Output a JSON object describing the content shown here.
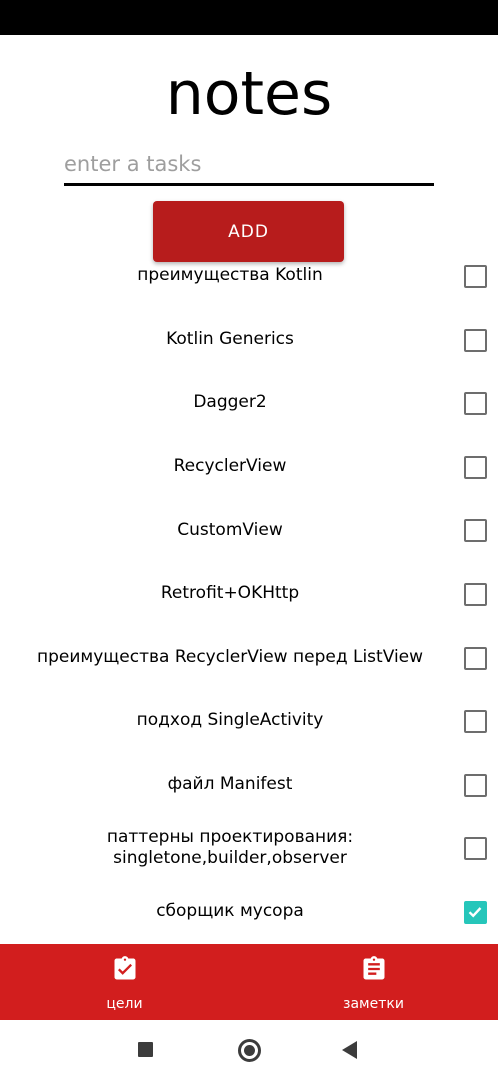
{
  "app": {
    "title": "notes"
  },
  "task_input": {
    "value": "",
    "placeholder": "enter a tasks"
  },
  "add_button": {
    "label": "ADD"
  },
  "tasks": [
    {
      "label": "преимущества Kotlin",
      "checked": false
    },
    {
      "label": "Kotlin Generics",
      "checked": false
    },
    {
      "label": "Dagger2",
      "checked": false
    },
    {
      "label": "RecyclerView",
      "checked": false
    },
    {
      "label": "CustomView",
      "checked": false
    },
    {
      "label": "Retrofit+OKHttp",
      "checked": false
    },
    {
      "label": "преимущества RecyclerView перед ListView",
      "checked": false
    },
    {
      "label": "подход SingleActivity",
      "checked": false
    },
    {
      "label": "файл Manifest",
      "checked": false
    },
    {
      "label": "паттерны проектирования: singletone,builder,observer",
      "checked": false
    },
    {
      "label": "сборщик мусора",
      "checked": true
    }
  ],
  "bottom_nav": {
    "items": [
      {
        "label": "цели",
        "icon": "clipboard-check-icon"
      },
      {
        "label": "заметки",
        "icon": "clipboard-text-icon"
      }
    ]
  },
  "system_nav": {
    "buttons": [
      "recents-icon",
      "home-icon",
      "back-icon"
    ]
  },
  "colors": {
    "accent": "#b71c1c",
    "nav_bar": "#d21e1e",
    "checkbox_checked": "#26c6ba"
  }
}
